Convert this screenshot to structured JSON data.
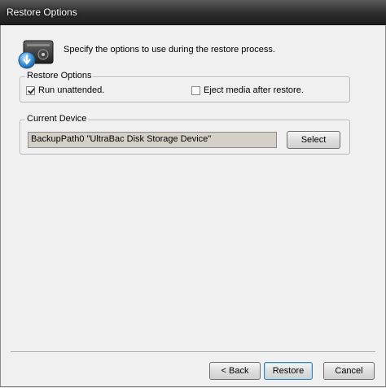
{
  "window": {
    "title": "Restore Options"
  },
  "header": {
    "text": "Specify the options to use during the restore process."
  },
  "restore_options": {
    "legend": "Restore Options",
    "run_unattended": {
      "label": "Run unattended.",
      "checked": true
    },
    "eject_media": {
      "label": "Eject media after restore.",
      "checked": false
    }
  },
  "current_device": {
    "legend": "Current Device",
    "value": "BackupPath0 \"UltraBac Disk Storage Device\"",
    "select_label": "Select"
  },
  "footer": {
    "back_label": "< Back",
    "restore_label": "Restore",
    "cancel_label": "Cancel"
  },
  "icons": {
    "header": "disk-restore-icon"
  }
}
